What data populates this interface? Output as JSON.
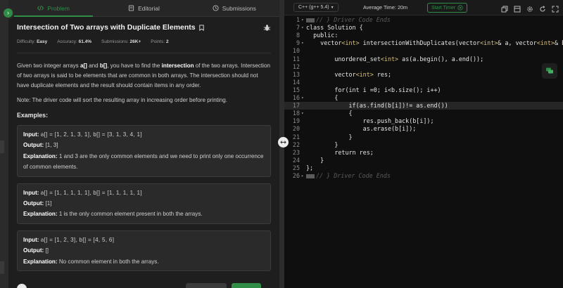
{
  "tabs": [
    {
      "label": "Problem",
      "icon": "code-icon"
    },
    {
      "label": "Editorial",
      "icon": "book-icon"
    },
    {
      "label": "Submissions",
      "icon": "clock-icon"
    }
  ],
  "problem": {
    "title": "Intersection of Two arrays with Duplicate Elements",
    "difficulty_label": "Difficulty:",
    "difficulty": "Easy",
    "accuracy_label": "Accuracy:",
    "accuracy": "61.4%",
    "submissions_label": "Submissions:",
    "submissions": "26K+",
    "points_label": "Points:",
    "points": "2",
    "desc": {
      "p1": "Given two integer arrays ",
      "a": "a[]",
      "and": " and ",
      "b": "b[]",
      "p2": ", you have to find the ",
      "intersection": "intersection",
      "p3": " of the two arrays. Intersection of two arrays is said to be elements that are common in both arrays. The intersection should not have duplicate elements and the result should contain items in any order."
    },
    "note": "Note: The driver code will sort the resulting array in increasing order before printing.",
    "examples_heading": "Examples:",
    "input_label": "Input:",
    "output_label": "Output:",
    "explanation_label": "Explanation:",
    "examples": [
      {
        "input": "a[] = [1, 2, 1, 3, 1], b[] = [3, 1, 3, 4, 1]",
        "output": "[1, 3]",
        "explanation": "1 and 3 are the only common elements and we need to print only one occurrence of common elements."
      },
      {
        "input": "a[] = [1, 1, 1, 1, 1], b[] = [1, 1, 1, 1, 1]",
        "output": "[1]",
        "explanation": "1 is the only common element present in both the arrays."
      },
      {
        "input": "a[] = [1, 2, 3], b[] = [4, 5, 6]",
        "output": "[]",
        "explanation": "No common element in both the arrays."
      }
    ]
  },
  "editor": {
    "language": "C++ (g++ 5.4)",
    "avg_time": "Average Time: 20m",
    "start_timer": "Start Timer",
    "lines": [
      {
        "n": "1",
        "fold": "▾",
        "text": "// } Driver Code Ends",
        "type": "comment"
      },
      {
        "n": "7",
        "fold": "▾",
        "text": "class Solution {",
        "type": "code"
      },
      {
        "n": "8",
        "fold": "",
        "text": "  public:",
        "type": "code"
      },
      {
        "n": "9",
        "fold": "▾",
        "text": "    vector<int> intersectionWithDuplicates(vector<int>& a, vector<int>& b) {",
        "type": "code"
      },
      {
        "n": "10",
        "fold": "",
        "text": "",
        "type": "code"
      },
      {
        "n": "11",
        "fold": "",
        "text": "        unordered_set<int> as(a.begin(), a.end());",
        "type": "code"
      },
      {
        "n": "12",
        "fold": "",
        "text": "",
        "type": "code"
      },
      {
        "n": "13",
        "fold": "",
        "text": "        vector<int> res;",
        "type": "code"
      },
      {
        "n": "14",
        "fold": "",
        "text": "",
        "type": "code"
      },
      {
        "n": "15",
        "fold": "",
        "text": "        for(int i =0; i<b.size(); i++)",
        "type": "code"
      },
      {
        "n": "16",
        "fold": "▾",
        "text": "        {",
        "type": "code"
      },
      {
        "n": "17",
        "fold": "",
        "text": "            if(as.find(b[i])!= as.end())",
        "type": "code",
        "highlight": true
      },
      {
        "n": "18",
        "fold": "▾",
        "text": "            {",
        "type": "code"
      },
      {
        "n": "19",
        "fold": "",
        "text": "                res.push_back(b[i]);",
        "type": "code"
      },
      {
        "n": "20",
        "fold": "",
        "text": "                as.erase(b[i]);",
        "type": "code"
      },
      {
        "n": "21",
        "fold": "",
        "text": "            }",
        "type": "code"
      },
      {
        "n": "22",
        "fold": "",
        "text": "        }",
        "type": "code"
      },
      {
        "n": "23",
        "fold": "",
        "text": "        return res;",
        "type": "code"
      },
      {
        "n": "24",
        "fold": "",
        "text": "    }",
        "type": "code"
      },
      {
        "n": "25",
        "fold": "",
        "text": "};",
        "type": "code"
      },
      {
        "n": "26",
        "fold": "▸",
        "text": "// } Driver Code Ends",
        "type": "comment"
      }
    ]
  },
  "colors": {
    "accent": "#2f8d46",
    "panel": "#1e1e1e",
    "editor_bg": "#0f0f0f"
  }
}
